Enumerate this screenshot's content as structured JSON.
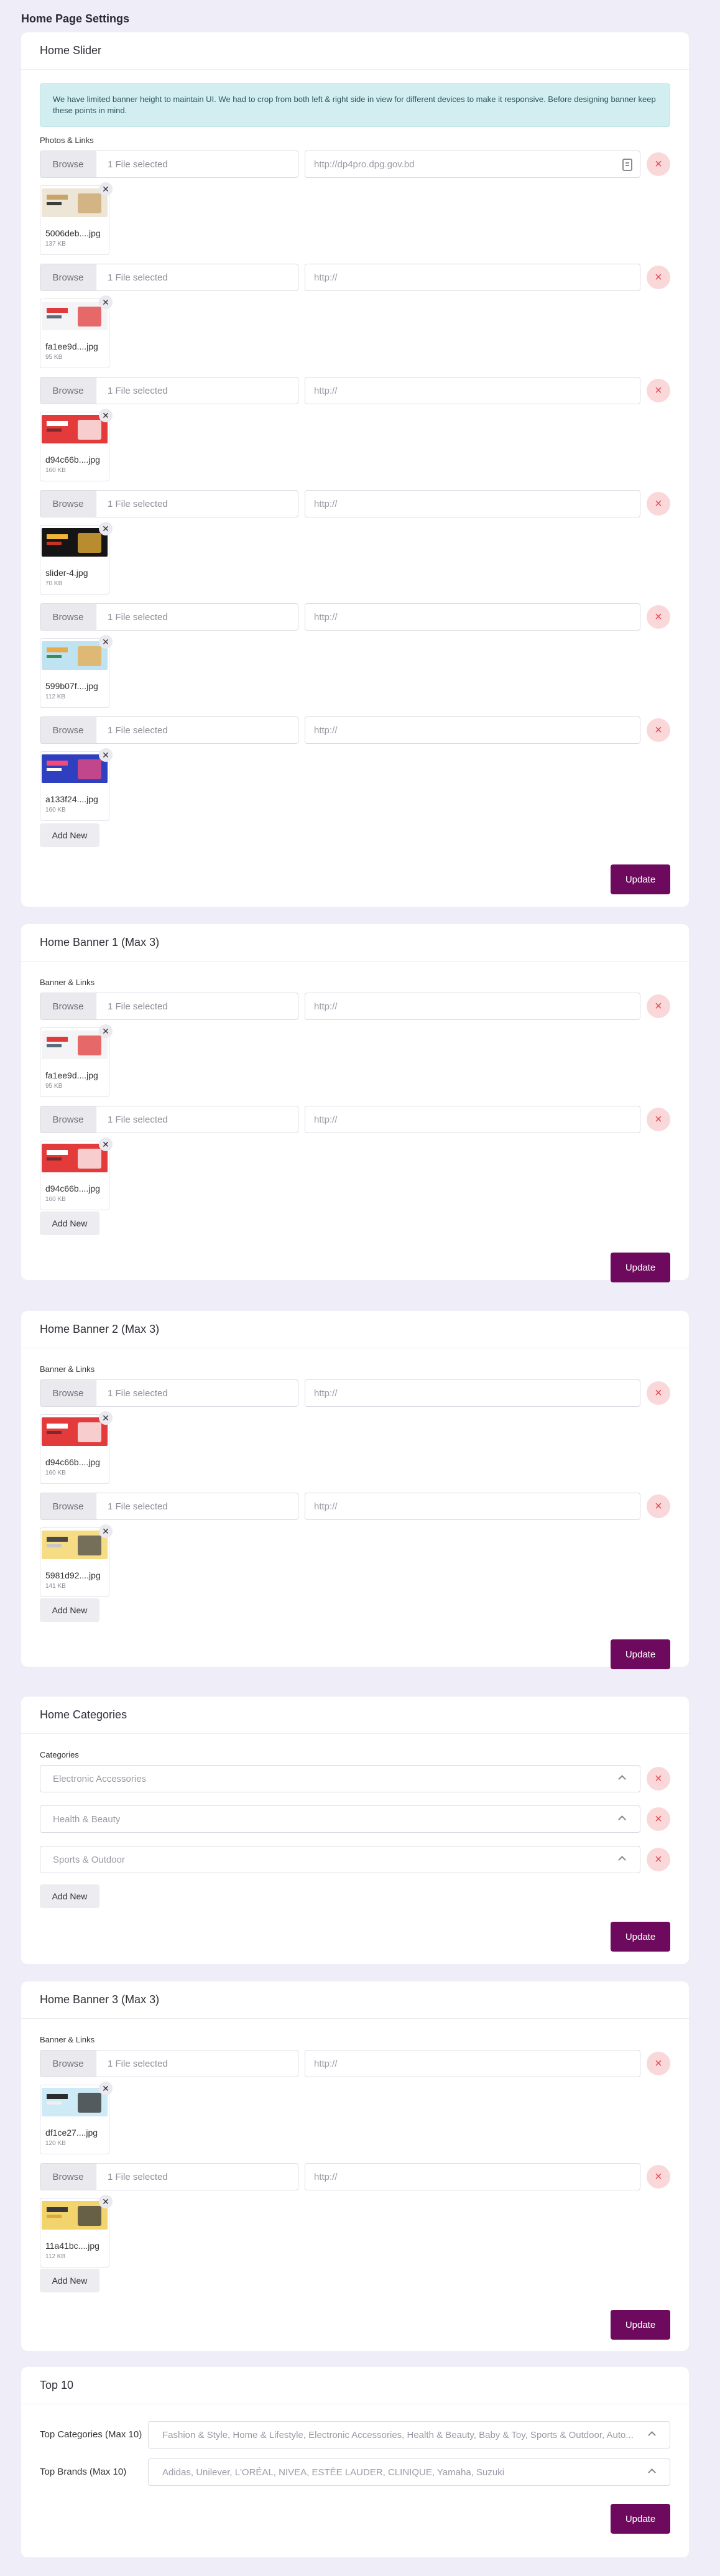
{
  "page_title": "Home Page Settings",
  "common": {
    "browse": "Browse",
    "file_selected": "1 File selected",
    "link_placeholder": "http://",
    "add_new": "Add New",
    "update": "Update",
    "remove_glyph": "×",
    "close_glyph": "✕"
  },
  "slider": {
    "title": "Home Slider",
    "notice": "We have limited banner height to maintain UI. We had to crop from both left & right side in view for different devices to make it responsive. Before designing banner keep these points in mind.",
    "label": "Photos & Links",
    "items": [
      {
        "link": "http://dp4pro.dpg.gov.bd",
        "file": "5006deb....jpg",
        "size": "137 KB",
        "thumb": "beige"
      },
      {
        "link": "http://",
        "file": "fa1ee9d....jpg",
        "size": "95 KB",
        "thumb": "white"
      },
      {
        "link": "http://",
        "file": "d94c66b....jpg",
        "size": "160 KB",
        "thumb": "red"
      },
      {
        "link": "http://",
        "file": "slider-4.jpg",
        "size": "70 KB",
        "thumb": "black"
      },
      {
        "link": "http://",
        "file": "599b07f....jpg",
        "size": "112 KB",
        "thumb": "lightblue"
      },
      {
        "link": "http://",
        "file": "a133f24....jpg",
        "size": "160 KB",
        "thumb": "blue"
      }
    ]
  },
  "banner1": {
    "title": "Home Banner 1 (Max 3)",
    "label": "Banner & Links",
    "items": [
      {
        "link": "http://",
        "file": "fa1ee9d....jpg",
        "size": "95 KB",
        "thumb": "white"
      },
      {
        "link": "http://",
        "file": "d94c66b....jpg",
        "size": "160 KB",
        "thumb": "red"
      }
    ]
  },
  "banner2": {
    "title": "Home Banner 2 (Max 3)",
    "label": "Banner & Links",
    "items": [
      {
        "link": "http://",
        "file": "d94c66b....jpg",
        "size": "160 KB",
        "thumb": "red"
      },
      {
        "link": "http://",
        "file": "5981d92....jpg",
        "size": "141 KB",
        "thumb": "yellow"
      }
    ]
  },
  "categories": {
    "title": "Home Categories",
    "label": "Categories",
    "items": [
      "Electronic Accessories",
      "Health & Beauty",
      "Sports & Outdoor"
    ]
  },
  "banner3": {
    "title": "Home Banner 3 (Max 3)",
    "label": "Banner & Links",
    "items": [
      {
        "link": "http://",
        "file": "df1ce27....jpg",
        "size": "120 KB",
        "thumb": "skyblue"
      },
      {
        "link": "http://",
        "file": "11a41bc....jpg",
        "size": "112 KB",
        "thumb": "gold"
      }
    ]
  },
  "top10": {
    "title": "Top 10",
    "categories_label": "Top Categories (Max 10)",
    "categories_value": "Fashion & Style, Home & Lifestyle, Electronic Accessories, Health & Beauty, Baby & Toy, Sports & Outdoor, Auto...",
    "brands_label": "Top Brands (Max 10)",
    "brands_value": "Adidas, Unilever, L'ORÉAL, NIVEA, ESTĒE LAUDER, CLINIQUE, Yamaha, Suzuki"
  },
  "colors": {
    "page_bg": "#efedf7",
    "update_button": "#6d0a5d",
    "remove_button_bg": "#fad7d9",
    "remove_button_fg": "#e04e5a",
    "notice_bg": "#d2eef1"
  }
}
